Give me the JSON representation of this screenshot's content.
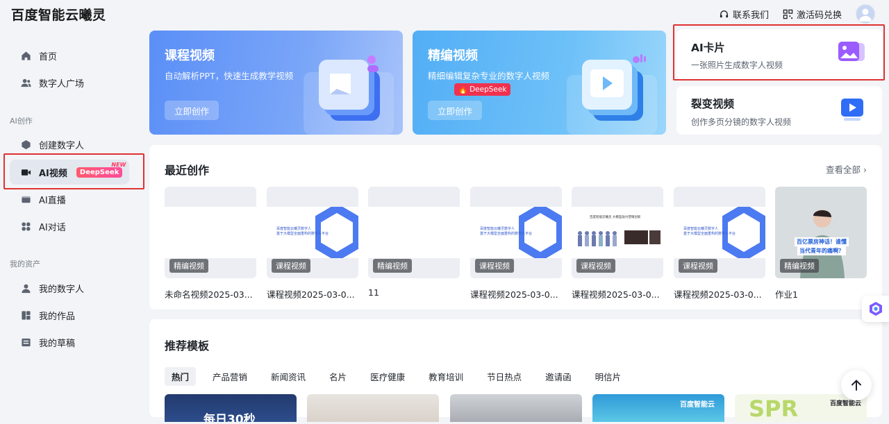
{
  "header": {
    "logo": "百度智能云曦灵",
    "contact": "联系我们",
    "redeem": "激活码兑换"
  },
  "sidebar": {
    "items": [
      {
        "label": "首页",
        "icon": "home-icon"
      },
      {
        "label": "数字人广场",
        "icon": "users-icon"
      }
    ],
    "section_ai": "AI创作",
    "ai_items": [
      {
        "label": "创建数字人",
        "icon": "hexagon-icon"
      },
      {
        "label": "AI视频",
        "icon": "video-icon",
        "badge": "DeepSeek",
        "new": "NEW"
      },
      {
        "label": "AI直播",
        "icon": "live-icon"
      },
      {
        "label": "AI对话",
        "icon": "chat-icon"
      }
    ],
    "section_assets": "我的资产",
    "asset_items": [
      {
        "label": "我的数字人",
        "icon": "person-icon"
      },
      {
        "label": "我的作品",
        "icon": "works-icon"
      },
      {
        "label": "我的草稿",
        "icon": "draft-icon"
      }
    ]
  },
  "feature_cards": {
    "course": {
      "title": "课程视频",
      "desc": "自动解析PPT，快速生成教学视频",
      "cta": "立即创作"
    },
    "edit": {
      "title": "精编视频",
      "desc": "精细编辑复杂专业的数字人视频",
      "cta": "立即创作",
      "badge": "DeepSeek"
    },
    "ai_card": {
      "title": "AI卡片",
      "desc": "一张照片生成数字人视频"
    },
    "fission": {
      "title": "裂变视频",
      "desc": "创作多页分镜的数字人视频"
    }
  },
  "recent": {
    "title": "最近创作",
    "see_all": "查看全部 ›",
    "items": [
      {
        "tag": "精编视频",
        "name": "未命名视频2025-03..."
      },
      {
        "tag": "课程视频",
        "name": "课程视频2025-03-0..."
      },
      {
        "tag": "精编视频",
        "name": "11"
      },
      {
        "tag": "课程视频",
        "name": "课程视频2025-03-0..."
      },
      {
        "tag": "课程视频",
        "name": "课程视频2025-03-0..."
      },
      {
        "tag": "课程视频",
        "name": "课程视频2025-03-0..."
      },
      {
        "tag": "精编视频",
        "name": "作业1"
      }
    ],
    "thumb_texts": {
      "slide_line1": "百度智能云曦灵数字人",
      "slide_line2": "基于大模型全面重构的数字人平台",
      "banner": "百度智能云曦灵 大模型助力营销创新",
      "person_caption_1": "百亿票房神话！谁懂",
      "person_caption_2": "当代青年的痛啊？"
    }
  },
  "templates": {
    "title": "推荐模板",
    "categories": [
      "热门",
      "产品营销",
      "新闻资讯",
      "名片",
      "医疗健康",
      "教育培训",
      "节日热点",
      "邀请函",
      "明信片"
    ],
    "tpl1_text": "每日30秒",
    "tpl4_brand": "百度智能云",
    "tpl5_brand": "百度智能云",
    "tpl5_text": "SPR"
  },
  "colors": {
    "accent_red": "#e03131",
    "deepseek": "#f0324f",
    "course_card": "#5b8ff7",
    "edit_card": "#53aef5"
  }
}
